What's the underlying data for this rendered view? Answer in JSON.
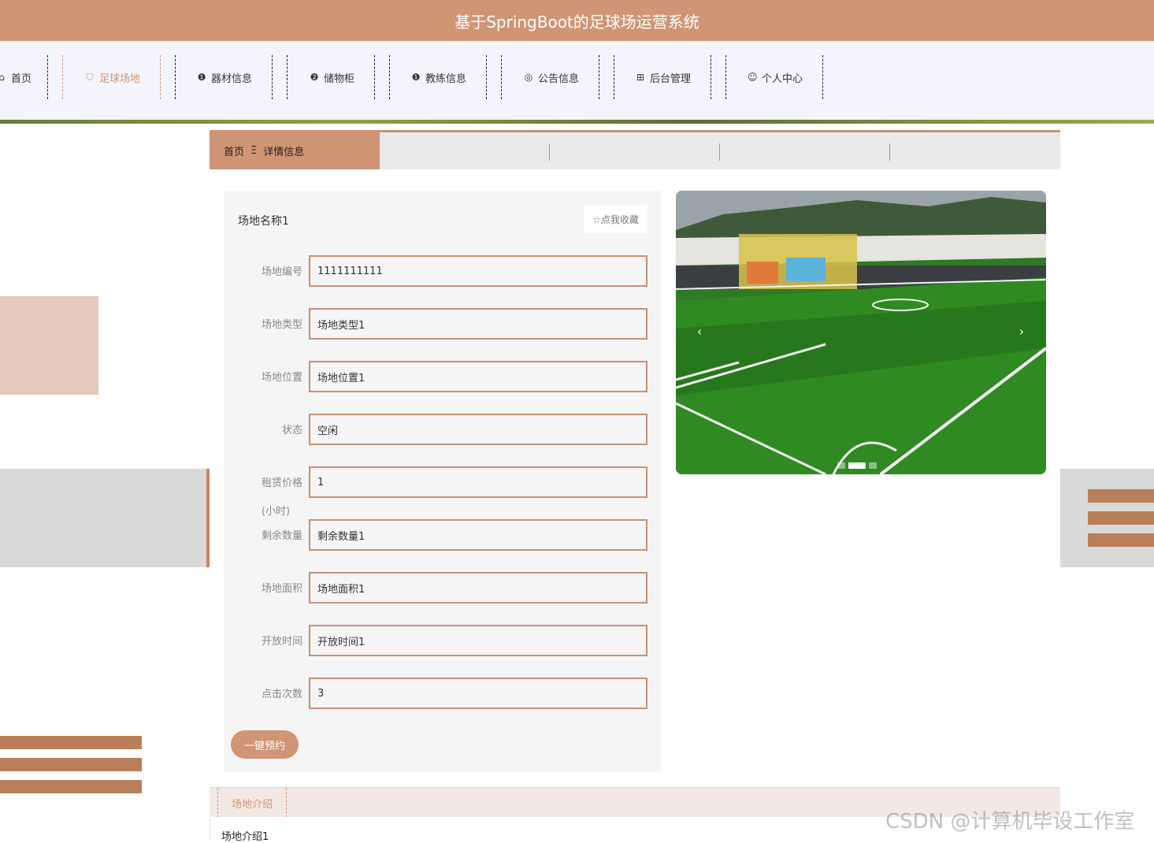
{
  "header": {
    "title": "基于SpringBoot的足球场运营系统"
  },
  "nav": {
    "items": [
      {
        "icon": "home-icon",
        "glyph": "⌂",
        "label": "首页"
      },
      {
        "icon": "bag-icon",
        "glyph": "⛉",
        "label": "足球场地"
      },
      {
        "icon": "info-circle-icon",
        "glyph": "❶",
        "label": "器材信息"
      },
      {
        "icon": "question-circle-icon",
        "glyph": "❷",
        "label": "储物柜"
      },
      {
        "icon": "info-circle-icon",
        "glyph": "❶",
        "label": "教练信息"
      },
      {
        "icon": "clock-icon",
        "glyph": "◎",
        "label": "公告信息"
      },
      {
        "icon": "gift-icon",
        "glyph": "⊞",
        "label": "后台管理"
      },
      {
        "icon": "user-icon",
        "glyph": "☺",
        "label": "个人中心"
      }
    ],
    "active": "足球场地"
  },
  "breadcrumb": {
    "home": "首页",
    "separator": "Ξ",
    "current": "详情信息"
  },
  "detail": {
    "name": "场地名称1",
    "favorite_label": "☆点我收藏",
    "fields": [
      {
        "label": "场地编号",
        "value": "1111111111"
      },
      {
        "label": "场地类型",
        "value": "场地类型1"
      },
      {
        "label": "场地位置",
        "value": "场地位置1"
      },
      {
        "label": "状态",
        "value": "空闲"
      },
      {
        "label": "租赁价格",
        "label_extra": "(小时)",
        "value": "1"
      },
      {
        "label": "剩余数量",
        "value": "剩余数量1"
      },
      {
        "label": "场地面积",
        "value": "场地面积1"
      },
      {
        "label": "开放时间",
        "value": "开放时间1"
      },
      {
        "label": "点击次数",
        "value": "3"
      }
    ],
    "book_label": "一键预约"
  },
  "carousel": {
    "prev": "‹",
    "next": "›",
    "dots": 3,
    "active_dot": 2
  },
  "intro": {
    "tab_label": "场地介绍",
    "content": "场地介绍1"
  },
  "watermark": "CSDN @计算机毕设工作室",
  "colors": {
    "accent": "#cf9574",
    "accent_dark": "#b87f5a",
    "nav_bg": "#f4f4fd"
  }
}
